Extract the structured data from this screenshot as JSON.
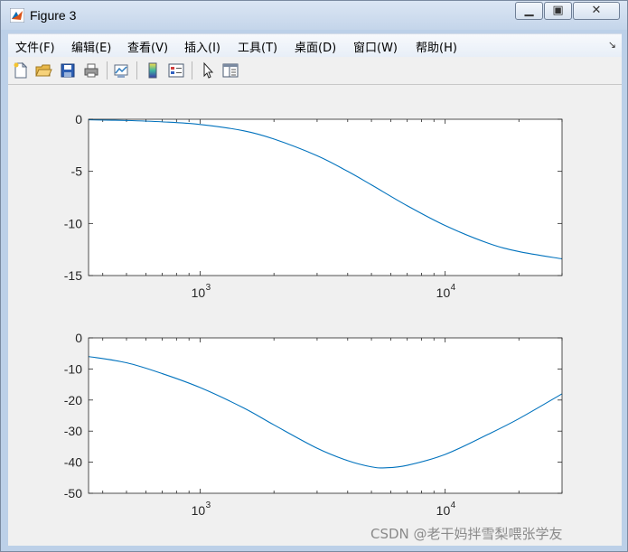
{
  "window": {
    "title": "Figure 3"
  },
  "menu": [
    "文件(F)",
    "编辑(E)",
    "查看(V)",
    "插入(I)",
    "工具(T)",
    "桌面(D)",
    "窗口(W)",
    "帮助(H)"
  ],
  "toolbar": {
    "icons": [
      "new-figure-icon",
      "open-file-icon",
      "save-icon",
      "print-icon",
      "link-plot-icon",
      "colorbar-icon",
      "legend-icon",
      "pointer-icon",
      "property-editor-icon"
    ]
  },
  "watermark": "CSDN @老干妈拌雪梨喂张学友",
  "chart_data": [
    {
      "type": "line",
      "xscale": "log",
      "xlim": [
        350,
        30000
      ],
      "ylim": [
        -15,
        0
      ],
      "yticks": [
        "0",
        "-5",
        "-10",
        "-15"
      ],
      "xtick_base": "10",
      "xtick_exponents": [
        "3",
        "4"
      ],
      "series": [
        {
          "x": [
            350,
            500,
            700,
            1000,
            1500,
            2000,
            3000,
            4000,
            5000,
            7000,
            10000,
            15000,
            20000,
            30000
          ],
          "y": [
            -0.05,
            -0.12,
            -0.25,
            -0.5,
            -1.1,
            -1.9,
            -3.5,
            -5.0,
            -6.3,
            -8.3,
            -10.2,
            -11.9,
            -12.7,
            -13.4
          ],
          "color": "#0072BD"
        }
      ]
    },
    {
      "type": "line",
      "xscale": "log",
      "xlim": [
        350,
        30000
      ],
      "ylim": [
        -50,
        0
      ],
      "yticks": [
        "0",
        "-10",
        "-20",
        "-30",
        "-40",
        "-50"
      ],
      "xtick_base": "10",
      "xtick_exponents": [
        "3",
        "4"
      ],
      "series": [
        {
          "x": [
            350,
            500,
            700,
            1000,
            1500,
            2000,
            3000,
            4000,
            5000,
            5700,
            7000,
            10000,
            15000,
            20000,
            30000
          ],
          "y": [
            -6,
            -8,
            -11.5,
            -16,
            -22.5,
            -28,
            -35.5,
            -39.5,
            -41.5,
            -41.8,
            -41,
            -37.5,
            -31,
            -26,
            -18
          ]
        }
      ]
    }
  ]
}
